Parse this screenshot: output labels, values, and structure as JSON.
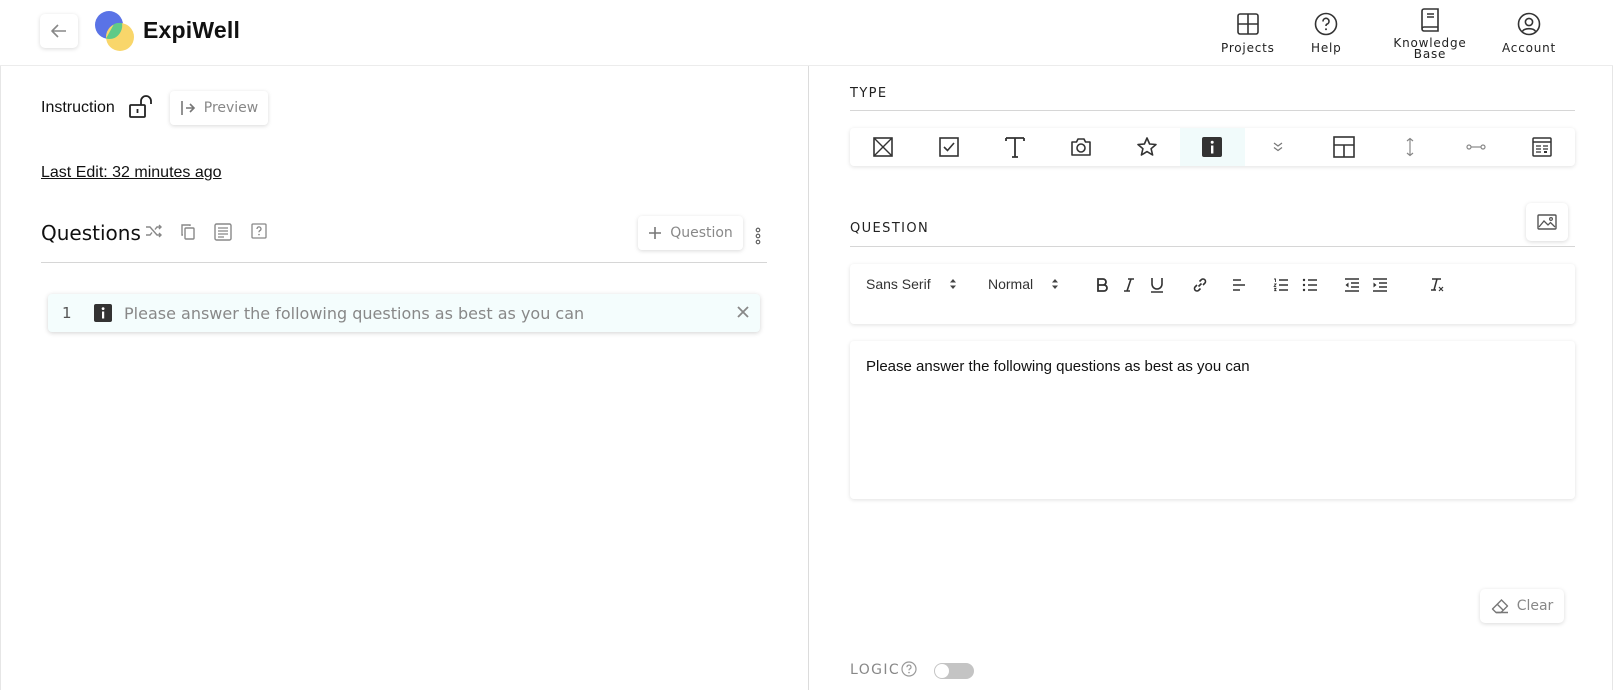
{
  "header": {
    "brand": "ExpiWell",
    "nav": [
      {
        "label": "Projects",
        "icon": "grid-icon"
      },
      {
        "label": "Help",
        "icon": "help-circle-icon"
      },
      {
        "label": "Knowledge Base",
        "icon": "book-icon"
      },
      {
        "label": "Account",
        "icon": "user-circle-icon"
      }
    ]
  },
  "left": {
    "instruction_label": "Instruction",
    "preview_label": "Preview",
    "last_edit": "Last Edit: 32 minutes ago",
    "questions_title": "Questions",
    "add_question_label": "Question",
    "questions": [
      {
        "number": "1",
        "text": "Please answer the following questions as best as you can",
        "type_icon": "info-icon"
      }
    ]
  },
  "right": {
    "type_label": "TYPE",
    "types": [
      "multiple-choice-icon",
      "checkbox-icon",
      "text-icon",
      "camera-icon",
      "star-icon",
      "info-icon",
      "dropdown-icon",
      "grid-layout-icon",
      "vertical-slider-icon",
      "horizontal-slider-icon",
      "matrix-icon"
    ],
    "active_type": "info-icon",
    "question_label": "QUESTION",
    "toolbar": {
      "font": "Sans Serif",
      "size": "Normal"
    },
    "editor_text": "Please answer the following questions as best as you can",
    "clear_label": "Clear",
    "logic_label": "LOGIC",
    "logic_enabled": false
  },
  "colors": {
    "active_bg": "#f1fbfb",
    "toggle_off": "#c4c4c4",
    "logo_blue": "#5a73e6",
    "logo_green": "#57c98a",
    "logo_yellow": "#f9d66a"
  }
}
